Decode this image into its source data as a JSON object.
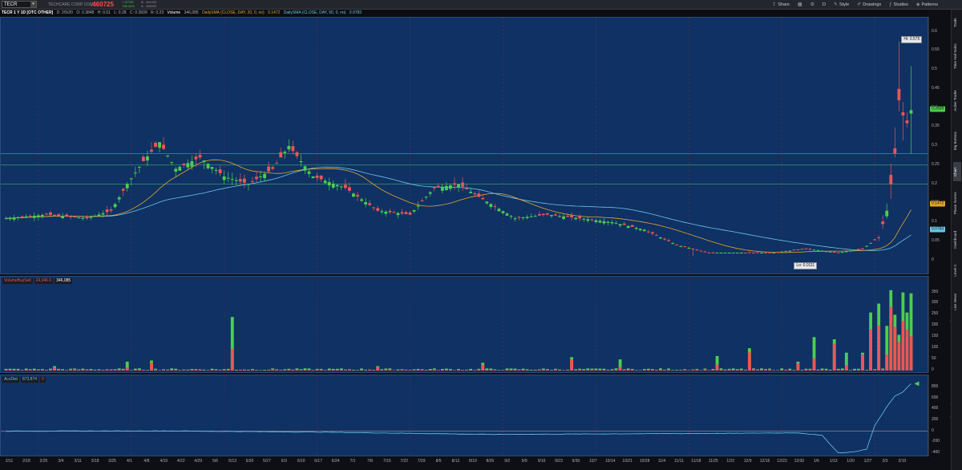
{
  "toolbar": {
    "symbol": "TECR",
    "company": "TECHCARE CORP COM",
    "last_price": ".460725",
    "change_line1": "+.37790",
    "change_line2": "+56.42%",
    "bid_line": "B: .451000",
    "ask_line": "A: .488900",
    "tools": [
      {
        "icon": "share-icon",
        "glyph": "⇪",
        "label": "Share"
      },
      {
        "icon": "grid-icon",
        "glyph": "▦",
        "label": ""
      },
      {
        "icon": "gear-icon",
        "glyph": "⚙",
        "label": ""
      },
      {
        "icon": "period-icon",
        "glyph": "",
        "label": "D"
      },
      {
        "icon": "style-icon",
        "glyph": "✎",
        "label": "Style"
      },
      {
        "icon": "drawings-icon",
        "glyph": "✐",
        "label": "Drawings"
      },
      {
        "icon": "studies-icon",
        "glyph": "ƒ",
        "label": "Studies"
      },
      {
        "icon": "patterns-icon",
        "glyph": "◈",
        "label": "Patterns"
      }
    ]
  },
  "infobar": {
    "title": "TECR 1 Y 1D [OTC OTHER]",
    "date": "D: 2/5/20",
    "open": "O: 0.3848",
    "high": "H: 0.51",
    "low": "L: 0.28",
    "close": "C: 0.3939",
    "range": "R: 0.23",
    "volume_label": "Volume",
    "volume_value": "346,085",
    "sma20_label": "DailySMA (CLOSE, DAY, 20, 0, no)",
    "sma20_value": "0.1472",
    "sma50_label": "DailySMA (CLOSE, DAY, 50, 0, no)",
    "sma50_value": "0.0783"
  },
  "colors": {
    "panel_bg": "#0f3163",
    "up": "#4ccf4c",
    "down": "#ee5555",
    "sma20": "#e2a52f",
    "sma50": "#6cc7ea",
    "hline": "#3f9a6e"
  },
  "price_axis": {
    "ticks": [
      "0.6",
      "0.55",
      "0.5",
      "0.45",
      "0.4",
      "0.35",
      "0.3",
      "0.25",
      "0.2",
      "0.15",
      "0.1",
      "0.05",
      "0"
    ],
    "badges": [
      {
        "text": "0.3939",
        "color": "#4ccf4c",
        "value": 0.3939
      },
      {
        "text": "0.1472",
        "color": "#e2a52f",
        "value": 0.1472
      },
      {
        "text": "0.0783",
        "color": "#6cc7ea",
        "value": 0.0783
      }
    ]
  },
  "callouts": {
    "high": "Hi: 0.575",
    "low": "Lo: 0.0111"
  },
  "volume": {
    "study_name": "VolumeBuySell",
    "value1": "24,346.6",
    "value2": "346,085",
    "axis_ticks": [
      "350",
      "300",
      "250",
      "200",
      "150",
      "100",
      "50",
      "0"
    ],
    "axis_label": "<thousands>"
  },
  "accdist": {
    "study_name": "AccDist",
    "value1": "873,874",
    "value2": "0",
    "axis_ticks": [
      "800",
      "600",
      "400",
      "200",
      "0",
      "-200",
      "-400"
    ],
    "axis_label": "<thousands>"
  },
  "xaxis": {
    "ticks": [
      "2/11",
      "2/18",
      "2/25",
      "3/4",
      "3/11",
      "3/18",
      "3/25",
      "4/1",
      "4/8",
      "4/15",
      "4/22",
      "4/29",
      "5/6",
      "5/13",
      "5/20",
      "5/27",
      "6/3",
      "6/10",
      "6/17",
      "6/24",
      "7/1",
      "7/8",
      "7/15",
      "7/22",
      "7/29",
      "8/5",
      "8/12",
      "8/19",
      "8/26",
      "9/2",
      "9/9",
      "9/16",
      "9/23",
      "9/30",
      "10/7",
      "10/14",
      "10/21",
      "10/28",
      "11/4",
      "11/11",
      "11/18",
      "11/25",
      "12/2",
      "12/9",
      "12/16",
      "12/23",
      "12/30",
      "1/6",
      "1/13",
      "1/20",
      "1/27",
      "2/3",
      "2/10"
    ]
  },
  "sidebar": {
    "tabs": [
      "Trade",
      "Time And Sales",
      "Active Trader",
      "Big Buttons",
      "Chart",
      "Phase Scores",
      "Dashboard",
      "Level II",
      "Live News"
    ],
    "active": "Chart"
  },
  "chart_data": [
    {
      "type": "candlestick",
      "title": "TECR 1 Y 1D [OTC OTHER]",
      "ylim": [
        -0.02,
        0.62
      ],
      "grid": true,
      "horizontal_lines": [
        0.28,
        0.25,
        0.2
      ],
      "anchors": [
        {
          "i": 0,
          "c": 0.11
        },
        {
          "i": 10,
          "c": 0.12
        },
        {
          "i": 20,
          "c": 0.11
        },
        {
          "i": 26,
          "c": 0.13
        },
        {
          "i": 30,
          "c": 0.2
        },
        {
          "i": 34,
          "c": 0.26
        },
        {
          "i": 38,
          "c": 0.31
        },
        {
          "i": 42,
          "c": 0.24
        },
        {
          "i": 48,
          "c": 0.27
        },
        {
          "i": 54,
          "c": 0.22
        },
        {
          "i": 60,
          "c": 0.2
        },
        {
          "i": 66,
          "c": 0.24
        },
        {
          "i": 70,
          "c": 0.3
        },
        {
          "i": 76,
          "c": 0.22
        },
        {
          "i": 84,
          "c": 0.19
        },
        {
          "i": 92,
          "c": 0.13
        },
        {
          "i": 100,
          "c": 0.12
        },
        {
          "i": 106,
          "c": 0.19
        },
        {
          "i": 112,
          "c": 0.2
        },
        {
          "i": 118,
          "c": 0.16
        },
        {
          "i": 126,
          "c": 0.11
        },
        {
          "i": 134,
          "c": 0.12
        },
        {
          "i": 142,
          "c": 0.11
        },
        {
          "i": 150,
          "c": 0.1
        },
        {
          "i": 158,
          "c": 0.08
        },
        {
          "i": 166,
          "c": 0.04
        },
        {
          "i": 174,
          "c": 0.02
        },
        {
          "i": 182,
          "c": 0.02
        },
        {
          "i": 190,
          "c": 0.02
        },
        {
          "i": 198,
          "c": 0.03
        },
        {
          "i": 206,
          "c": 0.02
        },
        {
          "i": 212,
          "c": 0.03
        },
        {
          "i": 216,
          "c": 0.06
        },
        {
          "i": 218,
          "c": 0.13
        },
        {
          "i": 219,
          "c": 0.2
        },
        {
          "i": 220,
          "c": 0.28
        },
        {
          "i": 221,
          "c": 0.42
        },
        {
          "i": 222,
          "c": 0.38
        },
        {
          "i": 223,
          "c": 0.36
        },
        {
          "i": 224,
          "c": 0.3939
        }
      ],
      "count": 225,
      "high": 0.575,
      "low": 0.0111
    },
    {
      "type": "bar",
      "title": "VolumeBuySell",
      "ylim": [
        0,
        370
      ],
      "spikes": [
        {
          "i": 12,
          "v": 20
        },
        {
          "i": 30,
          "v": 40
        },
        {
          "i": 36,
          "v": 45
        },
        {
          "i": 56,
          "v": 240
        },
        {
          "i": 92,
          "v": 20
        },
        {
          "i": 118,
          "v": 35
        },
        {
          "i": 140,
          "v": 60
        },
        {
          "i": 152,
          "v": 50
        },
        {
          "i": 176,
          "v": 65
        },
        {
          "i": 184,
          "v": 100
        },
        {
          "i": 196,
          "v": 40
        },
        {
          "i": 200,
          "v": 150
        },
        {
          "i": 205,
          "v": 140
        },
        {
          "i": 208,
          "v": 80
        },
        {
          "i": 212,
          "v": 80
        },
        {
          "i": 214,
          "v": 260
        },
        {
          "i": 216,
          "v": 300
        },
        {
          "i": 218,
          "v": 200
        },
        {
          "i": 219,
          "v": 360
        },
        {
          "i": 220,
          "v": 250
        },
        {
          "i": 221,
          "v": 160
        },
        {
          "i": 222,
          "v": 350
        },
        {
          "i": 223,
          "v": 260
        },
        {
          "i": 224,
          "v": 346
        }
      ]
    },
    {
      "type": "line",
      "title": "AccDist",
      "ylim": [
        -420,
        880
      ],
      "anchors": [
        {
          "i": 0,
          "v": 0
        },
        {
          "i": 40,
          "v": 5
        },
        {
          "i": 80,
          "v": -20
        },
        {
          "i": 120,
          "v": -60
        },
        {
          "i": 150,
          "v": -50
        },
        {
          "i": 180,
          "v": -40
        },
        {
          "i": 196,
          "v": -30
        },
        {
          "i": 202,
          "v": -80
        },
        {
          "i": 206,
          "v": -400
        },
        {
          "i": 210,
          "v": -380
        },
        {
          "i": 213,
          "v": -330
        },
        {
          "i": 215,
          "v": 100
        },
        {
          "i": 218,
          "v": 450
        },
        {
          "i": 220,
          "v": 650
        },
        {
          "i": 222,
          "v": 720
        },
        {
          "i": 224,
          "v": 873.874
        }
      ]
    }
  ]
}
